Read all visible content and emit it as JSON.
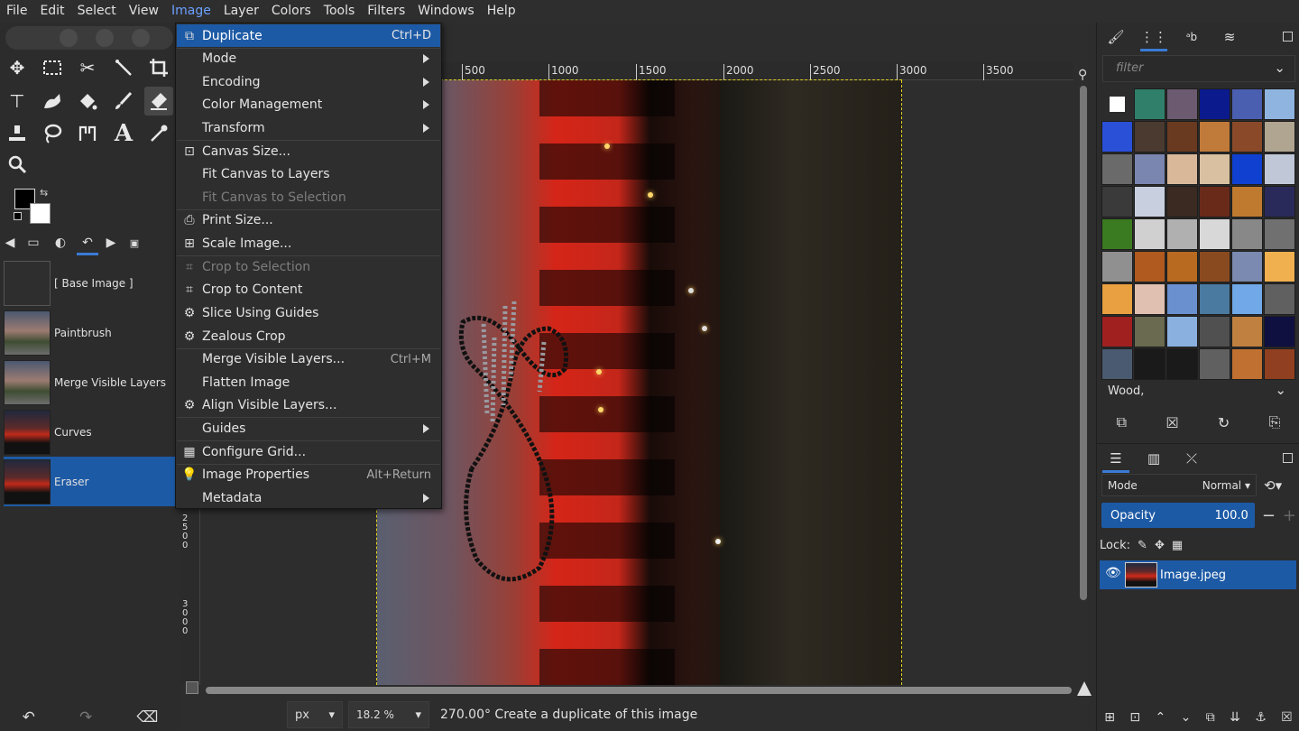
{
  "menubar": [
    "File",
    "Edit",
    "Select",
    "View",
    "Image",
    "Layer",
    "Colors",
    "Tools",
    "Filters",
    "Windows",
    "Help"
  ],
  "image_menu": {
    "items": [
      {
        "label": "Duplicate",
        "shortcut": "Ctrl+D",
        "icon": "duplicate-icon",
        "highlighted": true
      },
      {
        "label": "Mode",
        "submenu": true
      },
      {
        "label": "Encoding",
        "submenu": true
      },
      {
        "label": "Color Management",
        "submenu": true
      },
      {
        "label": "Transform",
        "submenu": true
      },
      {
        "label": "Canvas Size...",
        "icon": "canvas-size-icon"
      },
      {
        "label": "Fit Canvas to Layers"
      },
      {
        "label": "Fit Canvas to Selection",
        "disabled": true
      },
      {
        "label": "Print Size...",
        "icon": "printer-icon"
      },
      {
        "label": "Scale Image...",
        "icon": "scale-icon"
      },
      {
        "label": "Crop to Selection",
        "icon": "crop-icon",
        "disabled": true
      },
      {
        "label": "Crop to Content",
        "icon": "crop-icon"
      },
      {
        "label": "Slice Using Guides",
        "icon": "gear-icon"
      },
      {
        "label": "Zealous Crop",
        "icon": "gear-icon"
      },
      {
        "label": "Merge Visible Layers...",
        "shortcut": "Ctrl+M"
      },
      {
        "label": "Flatten Image"
      },
      {
        "label": "Align Visible Layers...",
        "icon": "gear-icon"
      },
      {
        "label": "Guides",
        "submenu": true
      },
      {
        "label": "Configure Grid...",
        "icon": "grid-icon"
      },
      {
        "label": "Image Properties",
        "shortcut": "Alt+Return",
        "icon": "info-bulb-icon"
      },
      {
        "label": "Metadata",
        "submenu": true
      }
    ]
  },
  "history": {
    "items": [
      "[ Base Image ]",
      "Paintbrush",
      "Merge Visible Layers",
      "Curves",
      "Eraser"
    ],
    "selected": "Eraser"
  },
  "ruler": {
    "h_ticks": [
      "500",
      "1000",
      "1500",
      "2000",
      "2500",
      "3000",
      "3500"
    ],
    "v_ticks_1": [
      "2",
      "5",
      "0",
      "0"
    ],
    "v_ticks_2": [
      "3",
      "0",
      "0",
      "0"
    ]
  },
  "statusbar": {
    "unit": "px",
    "zoom": "18.2 %",
    "message": "270.00° Create a duplicate of this image"
  },
  "right_panel": {
    "filter_placeholder": "filter",
    "pattern_name": "Wood,",
    "mode_label": "Mode",
    "mode_value": "Normal",
    "opacity_label": "Opacity",
    "opacity_value": "100.0",
    "lock_label": "Lock:",
    "layer_name": "Image.jpeg"
  },
  "colors": {
    "accent": "#1d5aa5",
    "menu_bg": "#2e2e2e",
    "selection": "#e0d020"
  }
}
